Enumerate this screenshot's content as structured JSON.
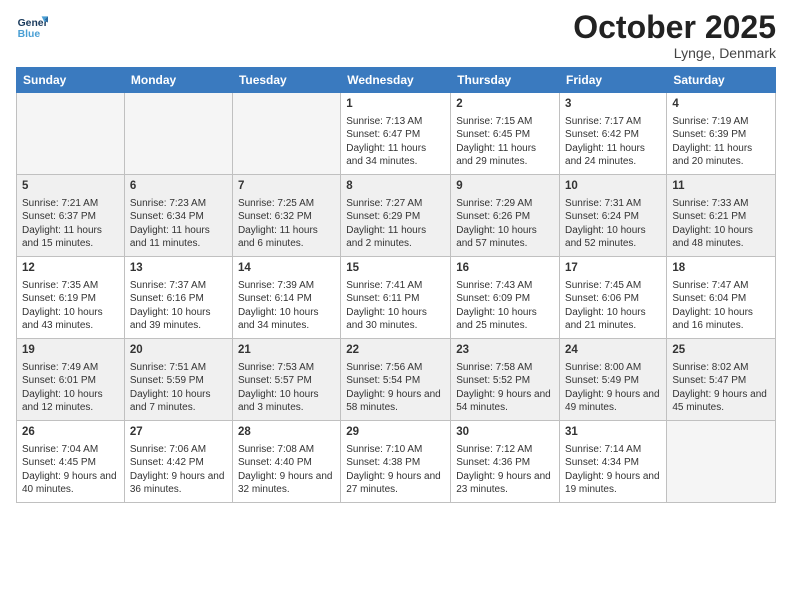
{
  "logo": {
    "line1": "General",
    "line2": "Blue"
  },
  "title": "October 2025",
  "location": "Lynge, Denmark",
  "days_header": [
    "Sunday",
    "Monday",
    "Tuesday",
    "Wednesday",
    "Thursday",
    "Friday",
    "Saturday"
  ],
  "weeks": [
    {
      "shaded": false,
      "days": [
        {
          "num": "",
          "info": ""
        },
        {
          "num": "",
          "info": ""
        },
        {
          "num": "",
          "info": ""
        },
        {
          "num": "1",
          "info": "Sunrise: 7:13 AM\nSunset: 6:47 PM\nDaylight: 11 hours and 34 minutes."
        },
        {
          "num": "2",
          "info": "Sunrise: 7:15 AM\nSunset: 6:45 PM\nDaylight: 11 hours and 29 minutes."
        },
        {
          "num": "3",
          "info": "Sunrise: 7:17 AM\nSunset: 6:42 PM\nDaylight: 11 hours and 24 minutes."
        },
        {
          "num": "4",
          "info": "Sunrise: 7:19 AM\nSunset: 6:39 PM\nDaylight: 11 hours and 20 minutes."
        }
      ]
    },
    {
      "shaded": true,
      "days": [
        {
          "num": "5",
          "info": "Sunrise: 7:21 AM\nSunset: 6:37 PM\nDaylight: 11 hours and 15 minutes."
        },
        {
          "num": "6",
          "info": "Sunrise: 7:23 AM\nSunset: 6:34 PM\nDaylight: 11 hours and 11 minutes."
        },
        {
          "num": "7",
          "info": "Sunrise: 7:25 AM\nSunset: 6:32 PM\nDaylight: 11 hours and 6 minutes."
        },
        {
          "num": "8",
          "info": "Sunrise: 7:27 AM\nSunset: 6:29 PM\nDaylight: 11 hours and 2 minutes."
        },
        {
          "num": "9",
          "info": "Sunrise: 7:29 AM\nSunset: 6:26 PM\nDaylight: 10 hours and 57 minutes."
        },
        {
          "num": "10",
          "info": "Sunrise: 7:31 AM\nSunset: 6:24 PM\nDaylight: 10 hours and 52 minutes."
        },
        {
          "num": "11",
          "info": "Sunrise: 7:33 AM\nSunset: 6:21 PM\nDaylight: 10 hours and 48 minutes."
        }
      ]
    },
    {
      "shaded": false,
      "days": [
        {
          "num": "12",
          "info": "Sunrise: 7:35 AM\nSunset: 6:19 PM\nDaylight: 10 hours and 43 minutes."
        },
        {
          "num": "13",
          "info": "Sunrise: 7:37 AM\nSunset: 6:16 PM\nDaylight: 10 hours and 39 minutes."
        },
        {
          "num": "14",
          "info": "Sunrise: 7:39 AM\nSunset: 6:14 PM\nDaylight: 10 hours and 34 minutes."
        },
        {
          "num": "15",
          "info": "Sunrise: 7:41 AM\nSunset: 6:11 PM\nDaylight: 10 hours and 30 minutes."
        },
        {
          "num": "16",
          "info": "Sunrise: 7:43 AM\nSunset: 6:09 PM\nDaylight: 10 hours and 25 minutes."
        },
        {
          "num": "17",
          "info": "Sunrise: 7:45 AM\nSunset: 6:06 PM\nDaylight: 10 hours and 21 minutes."
        },
        {
          "num": "18",
          "info": "Sunrise: 7:47 AM\nSunset: 6:04 PM\nDaylight: 10 hours and 16 minutes."
        }
      ]
    },
    {
      "shaded": true,
      "days": [
        {
          "num": "19",
          "info": "Sunrise: 7:49 AM\nSunset: 6:01 PM\nDaylight: 10 hours and 12 minutes."
        },
        {
          "num": "20",
          "info": "Sunrise: 7:51 AM\nSunset: 5:59 PM\nDaylight: 10 hours and 7 minutes."
        },
        {
          "num": "21",
          "info": "Sunrise: 7:53 AM\nSunset: 5:57 PM\nDaylight: 10 hours and 3 minutes."
        },
        {
          "num": "22",
          "info": "Sunrise: 7:56 AM\nSunset: 5:54 PM\nDaylight: 9 hours and 58 minutes."
        },
        {
          "num": "23",
          "info": "Sunrise: 7:58 AM\nSunset: 5:52 PM\nDaylight: 9 hours and 54 minutes."
        },
        {
          "num": "24",
          "info": "Sunrise: 8:00 AM\nSunset: 5:49 PM\nDaylight: 9 hours and 49 minutes."
        },
        {
          "num": "25",
          "info": "Sunrise: 8:02 AM\nSunset: 5:47 PM\nDaylight: 9 hours and 45 minutes."
        }
      ]
    },
    {
      "shaded": false,
      "days": [
        {
          "num": "26",
          "info": "Sunrise: 7:04 AM\nSunset: 4:45 PM\nDaylight: 9 hours and 40 minutes."
        },
        {
          "num": "27",
          "info": "Sunrise: 7:06 AM\nSunset: 4:42 PM\nDaylight: 9 hours and 36 minutes."
        },
        {
          "num": "28",
          "info": "Sunrise: 7:08 AM\nSunset: 4:40 PM\nDaylight: 9 hours and 32 minutes."
        },
        {
          "num": "29",
          "info": "Sunrise: 7:10 AM\nSunset: 4:38 PM\nDaylight: 9 hours and 27 minutes."
        },
        {
          "num": "30",
          "info": "Sunrise: 7:12 AM\nSunset: 4:36 PM\nDaylight: 9 hours and 23 minutes."
        },
        {
          "num": "31",
          "info": "Sunrise: 7:14 AM\nSunset: 4:34 PM\nDaylight: 9 hours and 19 minutes."
        },
        {
          "num": "",
          "info": ""
        }
      ]
    }
  ]
}
